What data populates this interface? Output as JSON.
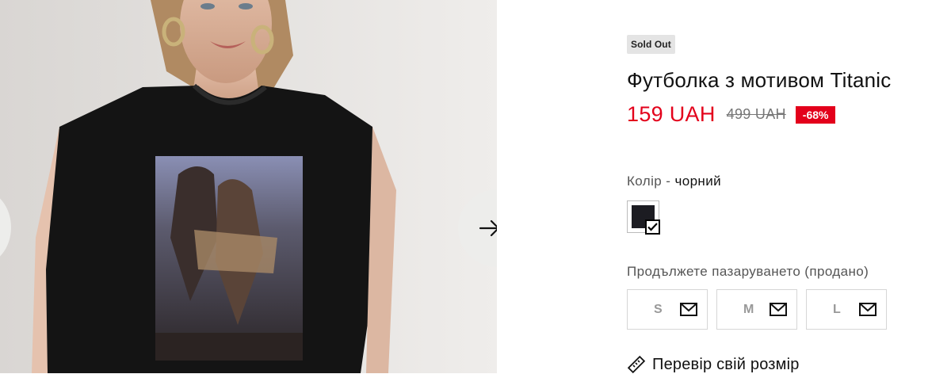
{
  "product": {
    "badge": "Sold Out",
    "title": "Футболка з мотивом Titanic",
    "price": "159 UAH",
    "old_price": "499 UAH",
    "discount": "-68%"
  },
  "color": {
    "label": "Колір",
    "separator": " - ",
    "value": "чорний",
    "swatch_hex": "#1c1c22"
  },
  "sizes": {
    "label": "Продължете пазаруването (продано)",
    "items": [
      {
        "label": "S",
        "icon": "mail-icon"
      },
      {
        "label": "M",
        "icon": "mail-icon"
      },
      {
        "label": "L",
        "icon": "mail-icon"
      }
    ]
  },
  "size_guide": {
    "label": "Перевір свій розмір",
    "icon": "ruler-icon"
  },
  "gallery": {
    "prev_icon": "arrow-left-icon",
    "next_icon": "arrow-right-icon"
  },
  "colors": {
    "accent_red": "#e3001b",
    "badge_bg": "#e4e4e4"
  }
}
